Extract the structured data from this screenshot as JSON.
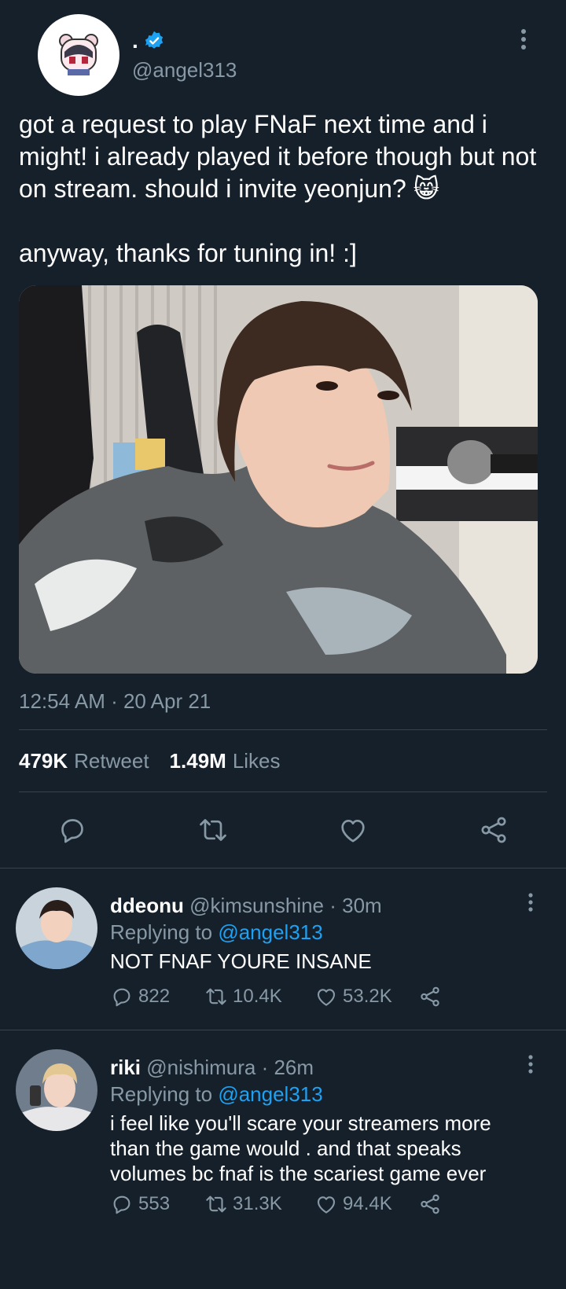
{
  "tweet": {
    "display_name": ".",
    "handle": "@angel313",
    "text": "got a request to play FNaF next time and i might! i already played it before though but not on stream. should i invite yeonjun? 😸\n\nanyway, thanks for tuning in! :]",
    "timestamp": "12:54 AM · 20 Apr 21",
    "retweets_count": "479K",
    "retweets_label": "Retweet",
    "likes_count": "1.49M",
    "likes_label": "Likes"
  },
  "replies": [
    {
      "name": "ddeonu",
      "handle_time": "@kimsunshine · 30m",
      "replying_label": "Replying to",
      "replying_to": "@angel313",
      "text": "NOT FNAF YOURE INSANE",
      "reply_count": "822",
      "retweet_count": "10.4K",
      "like_count": "53.2K"
    },
    {
      "name": "riki",
      "handle_time": "@nishimura · 26m",
      "replying_label": "Replying to",
      "replying_to": "@angel313",
      "text": "i feel like you'll scare your streamers more than the game would . and that speaks volumes bc fnaf is the scariest game ever",
      "reply_count": "553",
      "retweet_count": "31.3K",
      "like_count": "94.4K"
    }
  ],
  "colors": {
    "background": "#15202b",
    "secondary_text": "#8899a6",
    "link": "#1da1f2",
    "divider": "#38444d"
  },
  "icons": [
    "verified-badge-icon",
    "more-vertical-icon",
    "reply-icon",
    "retweet-icon",
    "like-icon",
    "share-icon"
  ]
}
